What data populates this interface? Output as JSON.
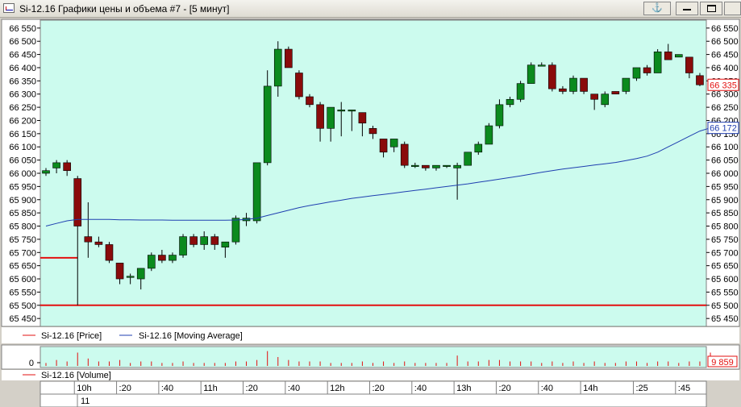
{
  "window": {
    "title": "Si-12.16 Графики цены и объема #7 - [5 минут]",
    "anchor_glyph": "⚓"
  },
  "colors": {
    "plot_bg": "#ccfbee",
    "up_candle": "#0b8a1e",
    "down_candle": "#8a0b0b",
    "ma_line": "#1f3fb0",
    "level_line": "#e31010",
    "volume_bar": "#e31010"
  },
  "chart_data": [
    {
      "type": "candlestick",
      "y_ticks": [
        "66 550",
        "66 500",
        "66 450",
        "66 400",
        "66 350",
        "66 300",
        "66 250",
        "66 200",
        "66 150",
        "66 100",
        "66 050",
        "66 000",
        "65 950",
        "65 900",
        "65 850",
        "65 800",
        "65 750",
        "65 700",
        "65 650",
        "65 600",
        "65 550",
        "65 500",
        "65 450"
      ],
      "ylim": [
        65420,
        66580
      ],
      "candles": [
        {
          "o": 66000,
          "h": 66020,
          "l": 65990,
          "c": 66010
        },
        {
          "o": 66020,
          "h": 66050,
          "l": 66000,
          "c": 66040
        },
        {
          "o": 66040,
          "h": 66050,
          "l": 65990,
          "c": 66010
        },
        {
          "o": 65980,
          "h": 65990,
          "l": 65500,
          "c": 65800
        },
        {
          "o": 65760,
          "h": 65890,
          "l": 65680,
          "c": 65740
        },
        {
          "o": 65740,
          "h": 65760,
          "l": 65720,
          "c": 65730
        },
        {
          "o": 65730,
          "h": 65740,
          "l": 65660,
          "c": 65670
        },
        {
          "o": 65660,
          "h": 65660,
          "l": 65580,
          "c": 65600
        },
        {
          "o": 65610,
          "h": 65620,
          "l": 65580,
          "c": 65610
        },
        {
          "o": 65600,
          "h": 65640,
          "l": 65560,
          "c": 65640
        },
        {
          "o": 65640,
          "h": 65700,
          "l": 65630,
          "c": 65690
        },
        {
          "o": 65690,
          "h": 65710,
          "l": 65660,
          "c": 65670
        },
        {
          "o": 65670,
          "h": 65700,
          "l": 65660,
          "c": 65690
        },
        {
          "o": 65690,
          "h": 65770,
          "l": 65680,
          "c": 65760
        },
        {
          "o": 65760,
          "h": 65770,
          "l": 65720,
          "c": 65730
        },
        {
          "o": 65730,
          "h": 65780,
          "l": 65710,
          "c": 65760
        },
        {
          "o": 65760,
          "h": 65770,
          "l": 65710,
          "c": 65730
        },
        {
          "o": 65720,
          "h": 65740,
          "l": 65680,
          "c": 65740
        },
        {
          "o": 65740,
          "h": 65840,
          "l": 65730,
          "c": 65830
        },
        {
          "o": 65820,
          "h": 65850,
          "l": 65800,
          "c": 65830
        },
        {
          "o": 65820,
          "h": 65840,
          "l": 65810,
          "c": 66040
        },
        {
          "o": 66040,
          "h": 66390,
          "l": 66030,
          "c": 66330
        },
        {
          "o": 66330,
          "h": 66500,
          "l": 66290,
          "c": 66470
        },
        {
          "o": 66470,
          "h": 66480,
          "l": 66410,
          "c": 66400
        },
        {
          "o": 66380,
          "h": 66390,
          "l": 66280,
          "c": 66290
        },
        {
          "o": 66290,
          "h": 66300,
          "l": 66250,
          "c": 66260
        },
        {
          "o": 66260,
          "h": 66270,
          "l": 66120,
          "c": 66170
        },
        {
          "o": 66170,
          "h": 66250,
          "l": 66120,
          "c": 66250
        },
        {
          "o": 66240,
          "h": 66270,
          "l": 66140,
          "c": 66240
        },
        {
          "o": 66240,
          "h": 66240,
          "l": 66160,
          "c": 66240
        },
        {
          "o": 66230,
          "h": 66230,
          "l": 66140,
          "c": 66190
        },
        {
          "o": 66170,
          "h": 66180,
          "l": 66130,
          "c": 66150
        },
        {
          "o": 66130,
          "h": 66130,
          "l": 66060,
          "c": 66080
        },
        {
          "o": 66100,
          "h": 66130,
          "l": 66080,
          "c": 66130
        },
        {
          "o": 66110,
          "h": 66120,
          "l": 66020,
          "c": 66030
        },
        {
          "o": 66030,
          "h": 66040,
          "l": 66020,
          "c": 66030
        },
        {
          "o": 66030,
          "h": 66030,
          "l": 66010,
          "c": 66020
        },
        {
          "o": 66020,
          "h": 66030,
          "l": 66010,
          "c": 66030
        },
        {
          "o": 66030,
          "h": 66030,
          "l": 66020,
          "c": 66030
        },
        {
          "o": 66020,
          "h": 66040,
          "l": 65900,
          "c": 66030
        },
        {
          "o": 66030,
          "h": 66080,
          "l": 66030,
          "c": 66080
        },
        {
          "o": 66080,
          "h": 66120,
          "l": 66070,
          "c": 66110
        },
        {
          "o": 66110,
          "h": 66190,
          "l": 66110,
          "c": 66180
        },
        {
          "o": 66180,
          "h": 66280,
          "l": 66170,
          "c": 66260
        },
        {
          "o": 66260,
          "h": 66290,
          "l": 66250,
          "c": 66280
        },
        {
          "o": 66280,
          "h": 66350,
          "l": 66270,
          "c": 66340
        },
        {
          "o": 66340,
          "h": 66420,
          "l": 66340,
          "c": 66410
        },
        {
          "o": 66410,
          "h": 66420,
          "l": 66410,
          "c": 66410
        },
        {
          "o": 66410,
          "h": 66420,
          "l": 66310,
          "c": 66320
        },
        {
          "o": 66320,
          "h": 66330,
          "l": 66300,
          "c": 66310
        },
        {
          "o": 66310,
          "h": 66370,
          "l": 66300,
          "c": 66360
        },
        {
          "o": 66360,
          "h": 66360,
          "l": 66300,
          "c": 66310
        },
        {
          "o": 66300,
          "h": 66300,
          "l": 66240,
          "c": 66280
        },
        {
          "o": 66260,
          "h": 66310,
          "l": 66250,
          "c": 66300
        },
        {
          "o": 66310,
          "h": 66310,
          "l": 66300,
          "c": 66300
        },
        {
          "o": 66310,
          "h": 66360,
          "l": 66300,
          "c": 66360
        },
        {
          "o": 66360,
          "h": 66400,
          "l": 66350,
          "c": 66400
        },
        {
          "o": 66400,
          "h": 66410,
          "l": 66370,
          "c": 66380
        },
        {
          "o": 66380,
          "h": 66470,
          "l": 66380,
          "c": 66460
        },
        {
          "o": 66460,
          "h": 66490,
          "l": 66430,
          "c": 66430
        },
        {
          "o": 66440,
          "h": 66450,
          "l": 66440,
          "c": 66450
        },
        {
          "o": 66440,
          "h": 66440,
          "l": 66360,
          "c": 66380
        },
        {
          "o": 66370,
          "h": 66380,
          "l": 66330,
          "c": 66335
        }
      ],
      "moving_average": [
        65800,
        65810,
        65820,
        65825,
        65825,
        65825,
        65825,
        65824,
        65824,
        65823,
        65823,
        65823,
        65822,
        65822,
        65822,
        65822,
        65822,
        65822,
        65823,
        65825,
        65830,
        65840,
        65850,
        65860,
        65870,
        65878,
        65885,
        65892,
        65898,
        65905,
        65910,
        65915,
        65920,
        65925,
        65930,
        65935,
        65940,
        65945,
        65950,
        65955,
        65960,
        65966,
        65972,
        65978,
        65984,
        65990,
        65997,
        66004,
        66010,
        66016,
        66021,
        66026,
        66031,
        66036,
        66041,
        66048,
        66056,
        66065,
        66080,
        66100,
        66120,
        66140,
        66160,
        66172
      ],
      "horizontal_levels": [
        {
          "value": 65500,
          "full_width": true
        },
        {
          "value": 65680,
          "full_width": false
        }
      ],
      "price_tags": [
        {
          "text": "66 335",
          "value": 66335
        },
        {
          "text": "66 172",
          "value": 66172
        }
      ]
    },
    {
      "type": "bar",
      "name": "Si-12.16 [Volume]",
      "y_tick": "0",
      "value_tag": "9 859",
      "volumes": [
        2,
        4,
        3,
        9,
        5,
        3,
        3,
        4,
        2,
        3,
        3,
        2,
        2,
        3,
        2,
        2,
        2,
        2,
        3,
        3,
        4,
        10,
        6,
        4,
        3,
        3,
        3,
        2,
        2,
        2,
        3,
        2,
        3,
        2,
        3,
        2,
        2,
        2,
        2,
        7,
        3,
        3,
        4,
        4,
        3,
        3,
        3,
        2,
        3,
        2,
        3,
        2,
        3,
        2,
        2,
        3,
        3,
        2,
        3,
        3,
        2,
        3,
        3,
        9
      ]
    }
  ],
  "legend": {
    "price_label": "Si-12.16 [Price]",
    "ma_label": "Si-12.16 [Moving Average]",
    "volume_label": "Si-12.16 [Volume]"
  },
  "time_axis": {
    "labels": [
      {
        "text": "10h",
        "candle": 3
      },
      {
        "text": ":20",
        "candle": 7
      },
      {
        "text": ":40",
        "candle": 11
      },
      {
        "text": "11h",
        "candle": 15
      },
      {
        "text": ":20",
        "candle": 19
      },
      {
        "text": ":40",
        "candle": 23
      },
      {
        "text": "12h",
        "candle": 27
      },
      {
        "text": ":20",
        "candle": 31
      },
      {
        "text": ":40",
        "candle": 35
      },
      {
        "text": "13h",
        "candle": 39
      },
      {
        "text": ":20",
        "candle": 43
      },
      {
        "text": ":40",
        "candle": 47
      },
      {
        "text": "14h",
        "candle": 51
      },
      {
        "text": ":25",
        "candle": 56
      },
      {
        "text": ":45",
        "candle": 60
      }
    ],
    "date_label": "11"
  }
}
